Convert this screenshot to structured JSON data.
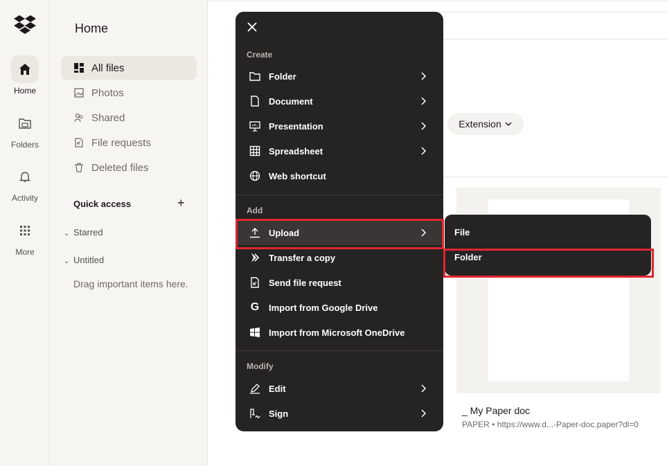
{
  "rail": {
    "items": [
      {
        "label": "Home",
        "icon": "home-icon"
      },
      {
        "label": "Folders",
        "icon": "folders-icon"
      },
      {
        "label": "Activity",
        "icon": "bell-icon"
      },
      {
        "label": "More",
        "icon": "grid-icon"
      }
    ]
  },
  "sidebar": {
    "title": "Home",
    "nav": [
      {
        "label": "All files",
        "icon": "all-files-icon"
      },
      {
        "label": "Photos",
        "icon": "photos-icon"
      },
      {
        "label": "Shared",
        "icon": "shared-icon"
      },
      {
        "label": "File requests",
        "icon": "file-requests-icon"
      },
      {
        "label": "Deleted files",
        "icon": "trash-icon"
      }
    ],
    "quick_access": "Quick access",
    "quick_access_add": "+",
    "sections": [
      "Starred",
      "Untitled"
    ],
    "drag_hint": "Drag important items here."
  },
  "main": {
    "filter_chip": "Extension",
    "file": {
      "name": "_ My Paper doc",
      "meta": "PAPER • https://www.d...-Paper-doc.paper?dl=0"
    }
  },
  "menu": {
    "groups": {
      "create": "Create",
      "add": "Add",
      "modify": "Modify"
    },
    "create_items": [
      {
        "label": "Folder",
        "icon": "folder-icon",
        "has_submenu": true
      },
      {
        "label": "Document",
        "icon": "document-icon",
        "has_submenu": true
      },
      {
        "label": "Presentation",
        "icon": "presentation-icon",
        "has_submenu": true
      },
      {
        "label": "Spreadsheet",
        "icon": "spreadsheet-icon",
        "has_submenu": true
      },
      {
        "label": "Web shortcut",
        "icon": "globe-icon",
        "has_submenu": false
      }
    ],
    "add_items": [
      {
        "label": "Upload",
        "icon": "upload-icon",
        "has_submenu": true
      },
      {
        "label": "Transfer a copy",
        "icon": "transfer-icon",
        "has_submenu": false
      },
      {
        "label": "Send file request",
        "icon": "file-request-icon",
        "has_submenu": false
      },
      {
        "label": "Import from Google Drive",
        "icon": "google-icon",
        "has_submenu": false
      },
      {
        "label": "Import from Microsoft OneDrive",
        "icon": "windows-icon",
        "has_submenu": false
      }
    ],
    "modify_items": [
      {
        "label": "Edit",
        "icon": "pencil-icon",
        "has_submenu": true
      },
      {
        "label": "Sign",
        "icon": "sign-icon",
        "has_submenu": true
      }
    ]
  },
  "submenu": {
    "items": [
      "File",
      "Folder"
    ]
  },
  "colors": {
    "menu_bg": "#262323",
    "highlight_border": "#e0262f",
    "sidebar_bg": "#f7f5f2",
    "brand": "#1e1919"
  }
}
